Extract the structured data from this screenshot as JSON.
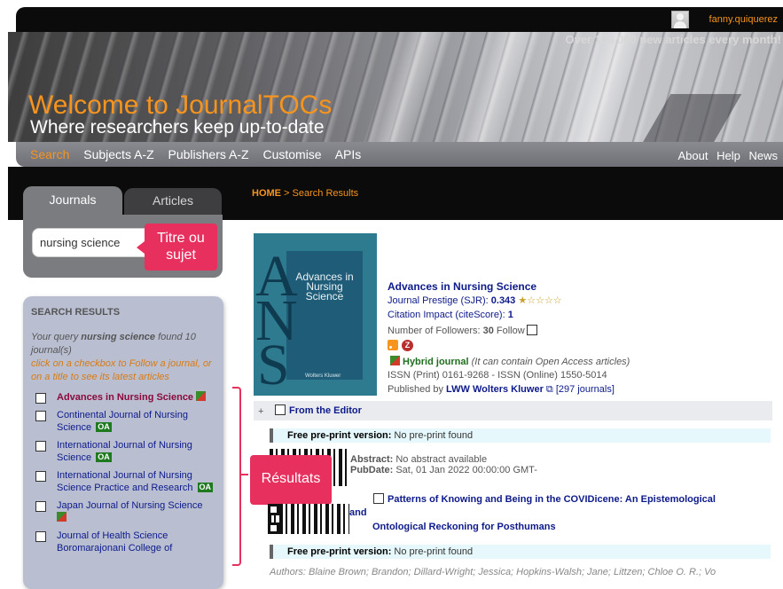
{
  "header": {
    "username": "fanny.quiquerez",
    "tagline": "Over 120,000 new articles every month!",
    "welcome": "Welcome to JournalTOCs",
    "subtitle": "Where researchers keep up-to-date"
  },
  "nav": {
    "left": [
      "Search",
      "Subjects A-Z",
      "Publishers A-Z",
      "Customise",
      "APIs"
    ],
    "right": [
      "About",
      "Help",
      "News"
    ]
  },
  "tabs": {
    "journals": "Journals",
    "articles": "Articles"
  },
  "breadcrumb": {
    "home": "HOME",
    "rest": " > Search Results"
  },
  "search": {
    "value": "nursing science"
  },
  "annotations": {
    "titre": "Titre ou sujet",
    "resultats": "Résultats"
  },
  "results": {
    "heading": "SEARCH RESULTS",
    "info_prefix": "Your query ",
    "info_query": "nursing science",
    "info_suffix": " found 10 journal(s)",
    "instructions": "click on a checkbox to Follow a journal, or on a title to see its latest articles",
    "oa_label": "OA",
    "items": [
      {
        "title": "Advances in Nursing Science"
      },
      {
        "title": "Continental Journal of Nursing Science"
      },
      {
        "title": "International Journal of Nursing Science"
      },
      {
        "title": "International Journal of Nursing Science Practice and Research"
      },
      {
        "title": "Japan Journal of Nursing Science"
      },
      {
        "title": "Journal of Health Science Boromarajonani College of"
      }
    ]
  },
  "journal": {
    "cover_text": "Advances in Nursing Science",
    "cover_brand": "Wolters Kluwer",
    "cover_letters": [
      "A",
      "N",
      "S"
    ],
    "title": "Advances in Nursing Science",
    "prestige_label": "Journal Prestige (SJR): ",
    "prestige_value": "0.343",
    "prestige_stars": 1,
    "citation_label": "Citation Impact (citeScore): ",
    "citation_value": "1",
    "followers_label": "Number of Followers: ",
    "followers_value": "30",
    "follow_label": "Follow",
    "hybrid_label": "Hybrid journal",
    "hybrid_note": "(It can contain Open Access articles)",
    "issn": "ISSN (Print) 0161-9268 - ISSN (Online) 1550-5014",
    "publisher_prefix": "Published by ",
    "publisher": "LWW Wolters Kluwer",
    "publisher_journals": "[297 journals]"
  },
  "articles": [
    {
      "title": "From the Editor",
      "preprint_label": "Free pre-print version:",
      "preprint_value": " No pre-print found",
      "abstract_label": "Abstract:",
      "abstract_value": " No abstract available",
      "pubdate_label": "PubDate:",
      "pubdate_value": " Sat, 01 Jan 2022 00:00:00 GMT-"
    },
    {
      "title_line1": "Patterns of Knowing and Being in the COVIDicene: An Epistemological",
      "title_and": "and",
      "title_line2": "Ontological Reckoning for Posthumans",
      "preprint_label": "Free pre-print version:",
      "preprint_value": " No pre-print found",
      "authors_label": "Authors:",
      "authors_value": " Blaine Brown; Brandon; Dillard-Wright; Jessica; Hopkins-Walsh; Jane; Littzen; Chloe O. R.; Vo"
    }
  ],
  "colors": {
    "accent": "#f7941d",
    "link": "#0d1a8a",
    "callout": "#e8305f",
    "oa_green": "#1f7a1f"
  }
}
